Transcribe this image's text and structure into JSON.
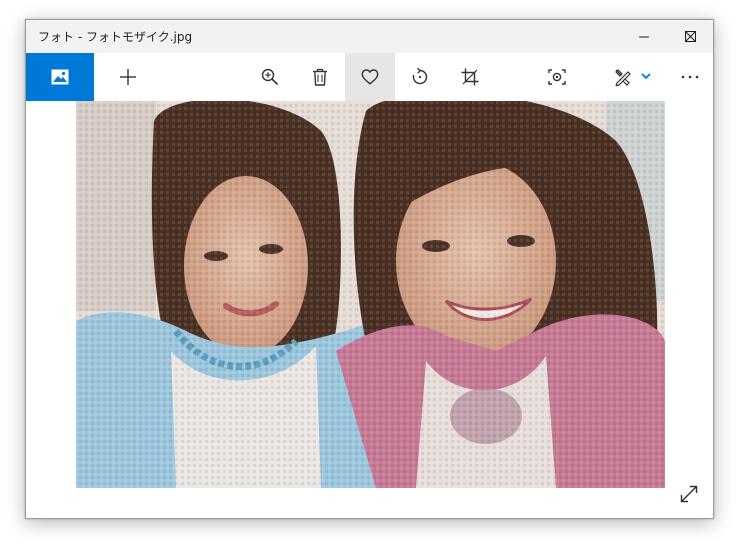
{
  "window": {
    "title": "フォト - フォトモザイク.jpg",
    "accent_color": "#0078d7"
  },
  "title_controls": [
    {
      "name": "minimize-icon"
    },
    {
      "name": "maximize-icon"
    },
    {
      "name": "close-icon"
    }
  ],
  "toolbar": {
    "left": [
      {
        "name": "gallery-icon",
        "active": true
      },
      {
        "name": "add-icon"
      }
    ],
    "right": [
      {
        "name": "zoom-in-icon"
      },
      {
        "name": "delete-icon"
      },
      {
        "name": "favorite-heart-icon",
        "active": true
      },
      {
        "name": "rotate-icon"
      },
      {
        "name": "crop-icon"
      },
      {
        "name": "focus-icon"
      },
      {
        "name": "edit-draw-icon"
      },
      {
        "name": "chevron-down-icon"
      },
      {
        "name": "more-options-icon"
      }
    ]
  },
  "photo": {
    "subject": "photo mosaic of two smiling women",
    "left_person_top_color": "#9cc7de",
    "right_person_top_color": "#c77996"
  },
  "bottom_right": {
    "name": "expand-fullscreen-icon"
  }
}
